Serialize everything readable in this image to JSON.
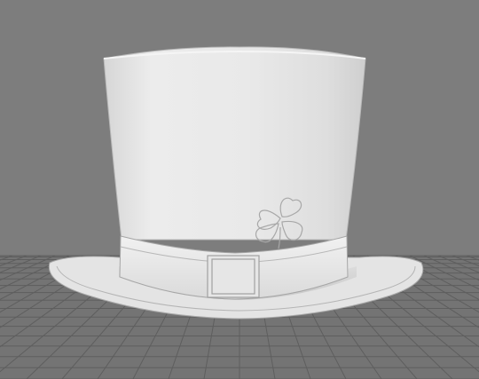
{
  "scene": {
    "background_color": "#7d7d7d",
    "floor_color": "#747474",
    "grid_line_color": "#5e5e5e",
    "model_color": "#e6e6e6",
    "model_shadow_color": "#bdbdbd",
    "object": "top-hat",
    "decoration": "four-leaf-clover-icon",
    "buckle": "square-buckle-icon"
  }
}
